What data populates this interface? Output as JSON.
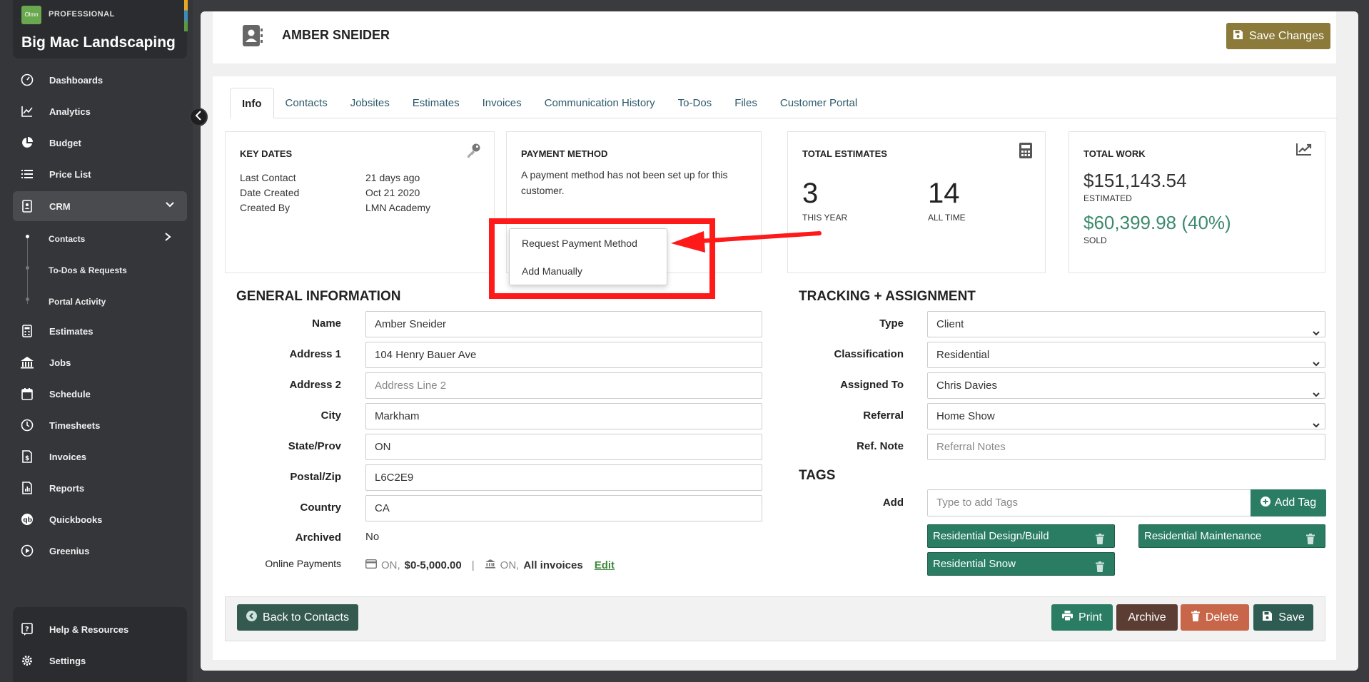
{
  "brand": {
    "logo_text": "Olmn",
    "edition": "PROFESSIONAL",
    "company": "Big Mac Landscaping"
  },
  "sidebar": {
    "items": [
      {
        "label": "Dashboards",
        "icon": "dashboard-icon"
      },
      {
        "label": "Analytics",
        "icon": "analytics-icon"
      },
      {
        "label": "Budget",
        "icon": "pie-chart-icon"
      },
      {
        "label": "Price List",
        "icon": "list-icon"
      },
      {
        "label": "CRM",
        "icon": "crm-icon"
      },
      {
        "label": "Estimates",
        "icon": "calculator-icon"
      },
      {
        "label": "Jobs",
        "icon": "building-icon"
      },
      {
        "label": "Schedule",
        "icon": "calendar-icon"
      },
      {
        "label": "Timesheets",
        "icon": "clock-icon"
      },
      {
        "label": "Invoices",
        "icon": "invoice-icon"
      },
      {
        "label": "Reports",
        "icon": "report-icon"
      },
      {
        "label": "Quickbooks",
        "icon": "quickbooks-icon"
      },
      {
        "label": "Greenius",
        "icon": "play-circle-icon"
      }
    ],
    "crm_sub": [
      "Contacts",
      "To-Dos & Requests",
      "Portal Activity"
    ],
    "bottom": [
      {
        "label": "Help & Resources",
        "icon": "help-icon"
      },
      {
        "label": "Settings",
        "icon": "gear-icon"
      }
    ]
  },
  "header": {
    "contact_name": "AMBER SNEIDER",
    "save_changes": "Save Changes"
  },
  "tabs": [
    "Info",
    "Contacts",
    "Jobsites",
    "Estimates",
    "Invoices",
    "Communication History",
    "To-Dos",
    "Files",
    "Customer Portal"
  ],
  "key_dates": {
    "title": "KEY DATES",
    "rows": [
      {
        "label": "Last Contact",
        "value": "21 days ago"
      },
      {
        "label": "Date Created",
        "value": "Oct 21 2020"
      },
      {
        "label": "Created By",
        "value": "LMN Academy"
      }
    ]
  },
  "payment_method": {
    "title": "PAYMENT METHOD",
    "message": "A payment method has not been set up for this customer.",
    "menu": [
      "Request Payment Method",
      "Add Manually"
    ]
  },
  "total_estimates": {
    "title": "TOTAL ESTIMATES",
    "this_year": "3",
    "this_year_label": "THIS YEAR",
    "all_time": "14",
    "all_time_label": "ALL TIME"
  },
  "total_work": {
    "title": "TOTAL WORK",
    "estimated": "$151,143.54",
    "estimated_label": "ESTIMATED",
    "sold": "$60,399.98 (40%)",
    "sold_label": "SOLD"
  },
  "general": {
    "title": "GENERAL INFORMATION",
    "fields": [
      {
        "label": "Name",
        "value": "Amber Sneider",
        "placeholder": ""
      },
      {
        "label": "Address 1",
        "value": "104 Henry Bauer Ave",
        "placeholder": ""
      },
      {
        "label": "Address 2",
        "value": "",
        "placeholder": "Address Line 2"
      },
      {
        "label": "City",
        "value": "Markham",
        "placeholder": ""
      },
      {
        "label": "State/Prov",
        "value": "ON",
        "placeholder": ""
      },
      {
        "label": "Postal/Zip",
        "value": "L6C2E9",
        "placeholder": ""
      },
      {
        "label": "Country",
        "value": "CA",
        "placeholder": ""
      }
    ],
    "archived_label": "Archived",
    "archived_value": "No",
    "online_label": "Online Payments",
    "card_on": "ON,",
    "card_range": "$0-5,000.00",
    "separator": "|",
    "bank_on": "ON,",
    "bank_scope": "All invoices",
    "edit": "Edit"
  },
  "tracking": {
    "title": "TRACKING + ASSIGNMENT",
    "fields": [
      {
        "label": "Type",
        "value": "Client"
      },
      {
        "label": "Classification",
        "value": "Residential"
      },
      {
        "label": "Assigned To",
        "value": "Chris Davies"
      },
      {
        "label": "Referral",
        "value": "Home Show"
      }
    ],
    "ref_note_label": "Ref. Note",
    "ref_note_placeholder": "Referral Notes"
  },
  "tags": {
    "title": "TAGS",
    "add_label": "Add",
    "input_placeholder": "Type to add Tags",
    "add_button": "Add Tag",
    "items": [
      "Residential Design/Build",
      "Residential Maintenance",
      "Residential Snow"
    ]
  },
  "footer": {
    "back": "Back to Contacts",
    "print": "Print",
    "archive": "Archive",
    "delete": "Delete",
    "save": "Save"
  },
  "colors": {
    "primary_green": "#2a7d62",
    "save_changes_gold": "#8b7a3a",
    "archive_brown": "#5c3d33",
    "delete_orange": "#c8664a",
    "back_dark_green": "#34594f",
    "annotation_red": "#ff1a1a"
  }
}
